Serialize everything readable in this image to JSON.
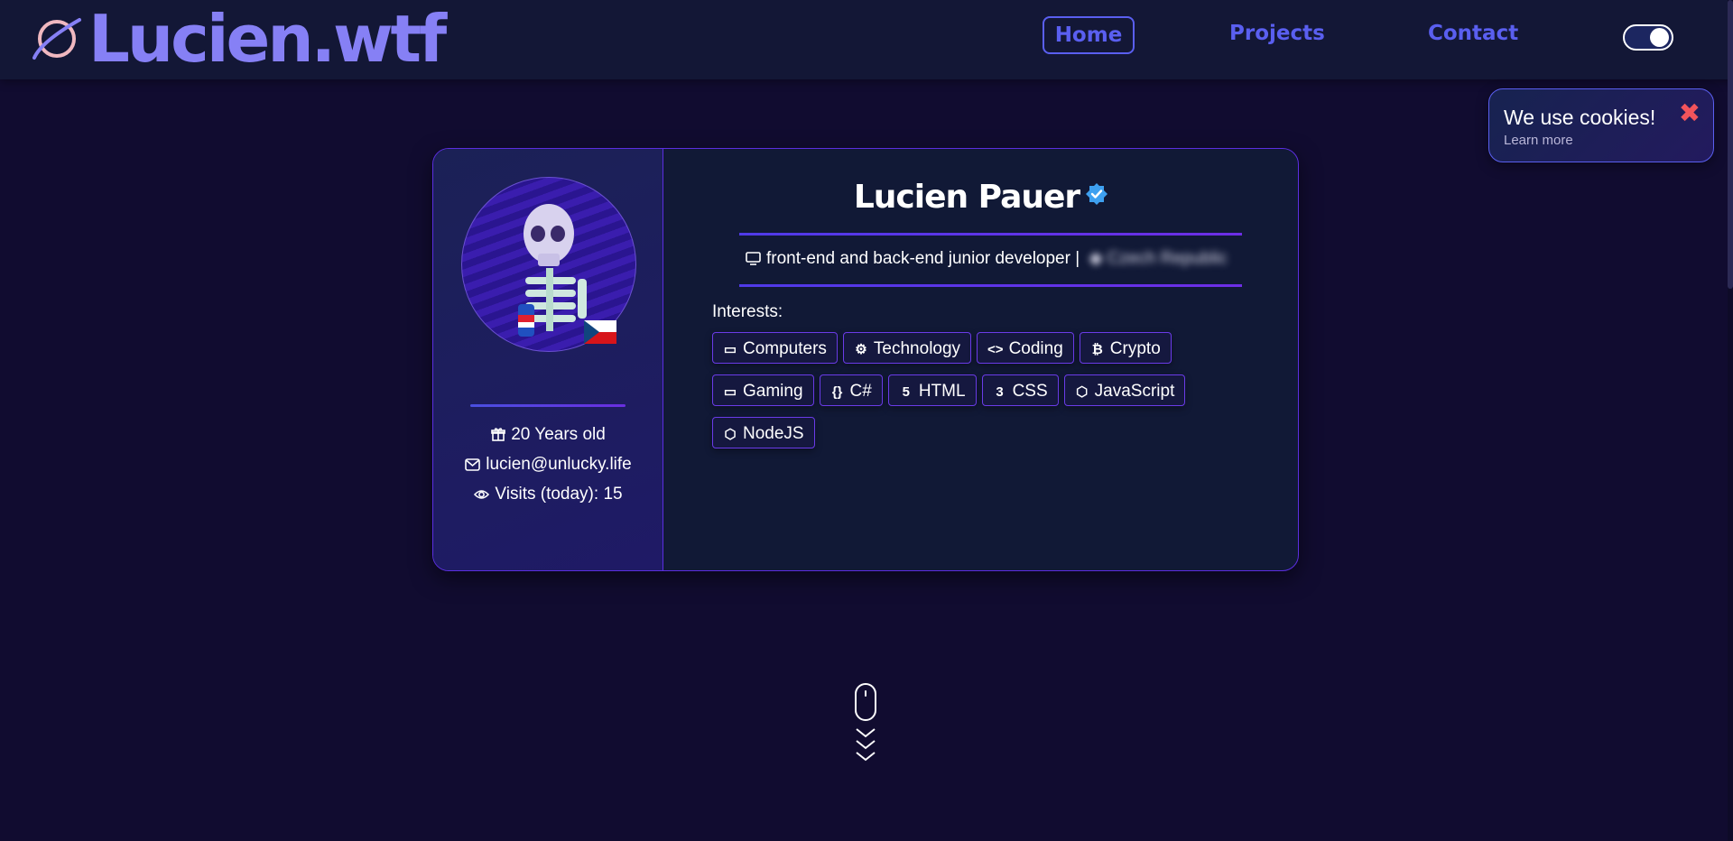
{
  "header": {
    "logo_text": "Lucien.wtf",
    "nav": {
      "home": "Home",
      "projects": "Projects",
      "contact": "Contact"
    },
    "theme_toggle_on": true
  },
  "cookie": {
    "title": "We use cookies!",
    "learn_more": "Learn more",
    "close_icon": "close-x-icon"
  },
  "profile": {
    "name": "Lucien Pauer",
    "age": "20 Years old",
    "email": "lucien@unlucky.life",
    "visits": "Visits (today): 15",
    "bio": "front-end and back-end junior developer |",
    "location": "Czech Republic",
    "interests_label": "Interests:",
    "interests": [
      {
        "label": "Computers",
        "icon": "monitor-icon"
      },
      {
        "label": "Technology",
        "icon": "robot-icon"
      },
      {
        "label": "Coding",
        "icon": "code-icon"
      },
      {
        "label": "Crypto",
        "icon": "bitcoin-icon"
      },
      {
        "label": "Gaming",
        "icon": "laptop-icon"
      },
      {
        "label": "C#",
        "icon": "braces-icon"
      },
      {
        "label": "HTML",
        "icon": "html5-icon"
      },
      {
        "label": "CSS",
        "icon": "css3-icon"
      },
      {
        "label": "JavaScript",
        "icon": "hexagon-icon"
      },
      {
        "label": "NodeJS",
        "icon": "hexagon-icon"
      }
    ]
  },
  "colors": {
    "accent": "#5a5ff0",
    "logo": "#8680f5",
    "border": "#5b2ee0",
    "background": "#110c30"
  }
}
